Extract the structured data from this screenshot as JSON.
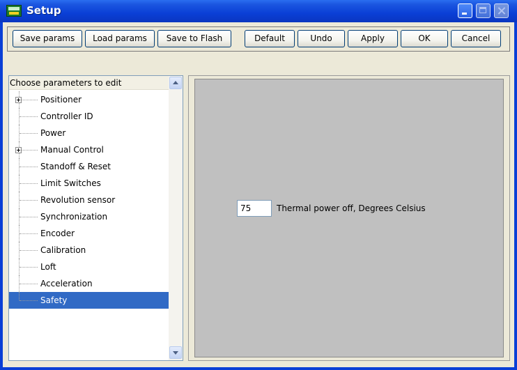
{
  "window": {
    "title": "Setup"
  },
  "toolbar": {
    "save_params": "Save params",
    "load_params": "Load params",
    "save_to_flash": "Save to Flash",
    "default": "Default",
    "undo": "Undo",
    "apply": "Apply",
    "ok": "OK",
    "cancel": "Cancel"
  },
  "tree": {
    "header": "Choose parameters to edit",
    "items": [
      {
        "label": "Positioner",
        "expandable": true
      },
      {
        "label": "Controller ID",
        "expandable": false
      },
      {
        "label": "Power",
        "expandable": false
      },
      {
        "label": "Manual Control",
        "expandable": true
      },
      {
        "label": "Standoff & Reset",
        "expandable": false
      },
      {
        "label": "Limit Switches",
        "expandable": false
      },
      {
        "label": "Revolution sensor",
        "expandable": false
      },
      {
        "label": "Synchronization",
        "expandable": false
      },
      {
        "label": "Encoder",
        "expandable": false
      },
      {
        "label": "Calibration",
        "expandable": false
      },
      {
        "label": "Loft",
        "expandable": false
      },
      {
        "label": "Acceleration",
        "expandable": false
      },
      {
        "label": "Safety",
        "expandable": false,
        "selected": true
      }
    ]
  },
  "param": {
    "value": "75",
    "label": "Thermal power off, Degrees Celsius"
  },
  "colors": {
    "title_bar": "#0a3fd6",
    "selection": "#316ac5",
    "panel": "#c0c0c0"
  }
}
